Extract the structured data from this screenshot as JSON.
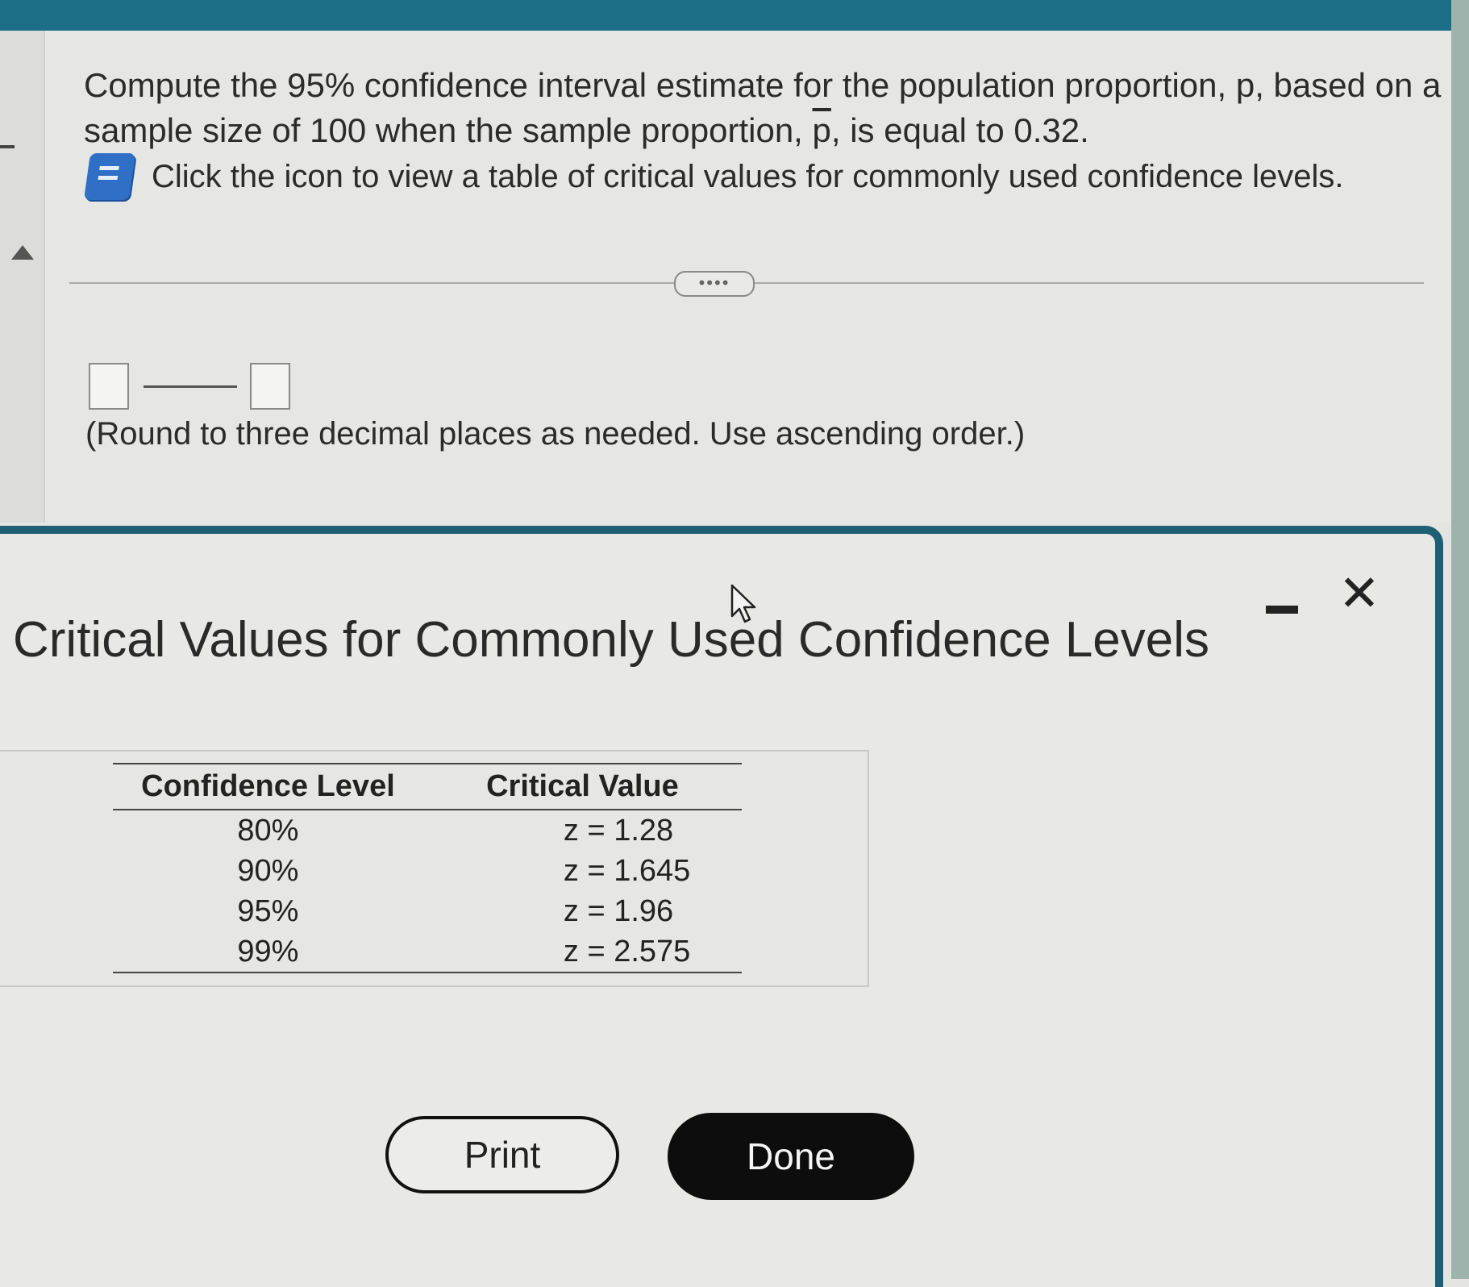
{
  "question": {
    "line_a": "Compute the 95% confidence interval estimate for the population proportion, p, based on a sample size of 100 when the sample proportion, ",
    "p_bar": "p",
    "line_b": ", is equal to 0.32.",
    "hint": "Click the icon to view a table of critical values for commonly used confidence levels.",
    "more_label": "••••",
    "round_note": "(Round to three decimal places as needed. Use ascending order.)"
  },
  "answer": {
    "lower_value": "",
    "upper_value": ""
  },
  "dialog": {
    "title": "Critical Values for Commonly Used Confidence Levels",
    "close_glyph": "✕",
    "table": {
      "headers": [
        "Confidence Level",
        "Critical Value"
      ],
      "rows": [
        {
          "level": "80%",
          "value": "z = 1.28"
        },
        {
          "level": "90%",
          "value": "z = 1.645"
        },
        {
          "level": "95%",
          "value": "z = 1.96"
        },
        {
          "level": "99%",
          "value": "z = 2.575"
        }
      ]
    },
    "print_label": "Print",
    "done_label": "Done"
  },
  "icons": {
    "book": "book-icon",
    "close": "close-icon",
    "minimize": "minimize-icon",
    "cursor": "mouse-cursor-icon"
  },
  "colors": {
    "header_bar": "#1d6f87",
    "dialog_border": "#1f5f74",
    "book_icon": "#2f6fc6",
    "done_button": "#0d0d0d"
  }
}
